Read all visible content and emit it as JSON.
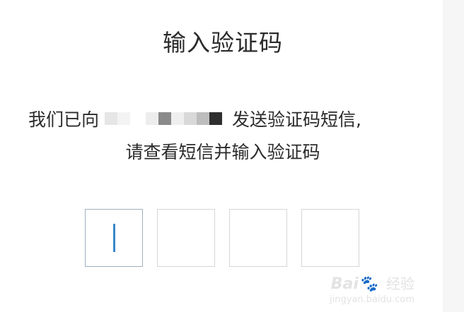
{
  "title": "输入验证码",
  "message": {
    "prefix": "我们已向",
    "suffix": "发送验证码短信,",
    "line2": "请查看短信并输入验证码"
  },
  "code_boxes": [
    {
      "value": "",
      "focused": true
    },
    {
      "value": "",
      "focused": false
    },
    {
      "value": "",
      "focused": false
    },
    {
      "value": "",
      "focused": false
    }
  ],
  "colors": {
    "caret": "#3a86c8",
    "text": "#2b2b2b",
    "box_border": "#d6d6d6"
  },
  "watermark": {
    "logo": "Bai🐾 ",
    "cn": "经验",
    "url": "jingyan.baidu.com"
  }
}
